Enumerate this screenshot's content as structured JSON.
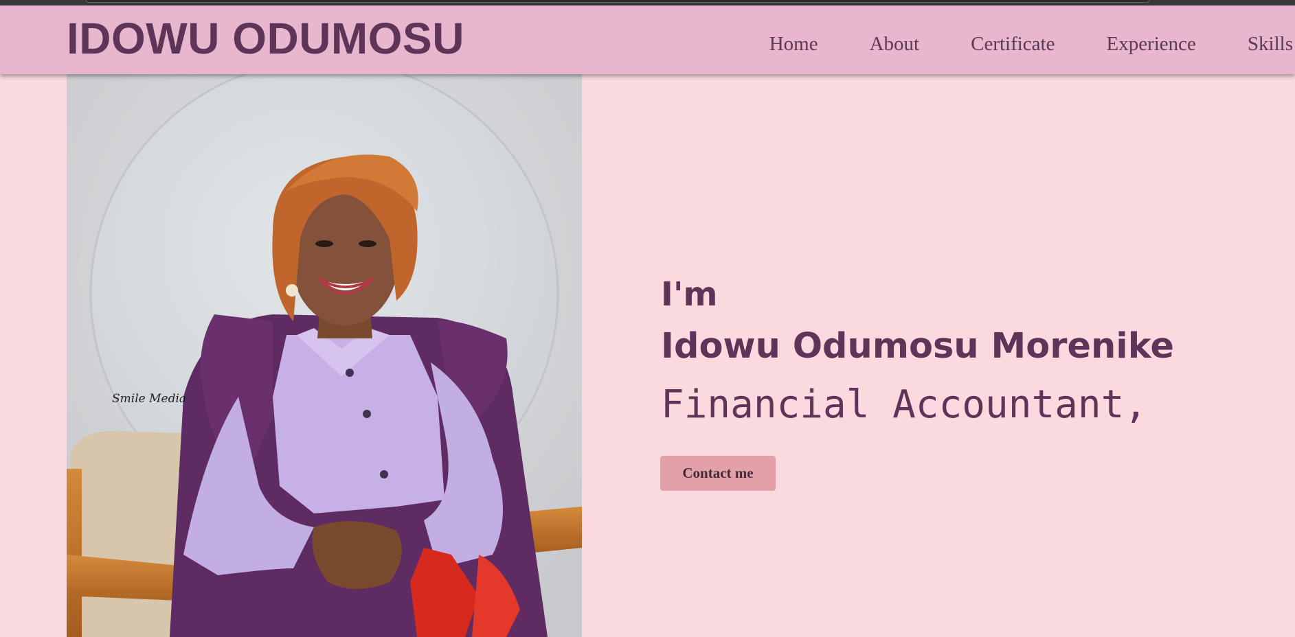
{
  "header": {
    "logo": "IDOWU ODUMOSU",
    "nav": [
      "Home",
      "About",
      "Certificate",
      "Experience",
      "Skills"
    ]
  },
  "hero": {
    "greeting": "I'm",
    "name": "Idowu Odumosu Morenike",
    "role": "Financial Accountant,",
    "contact_button": "Contact me",
    "photo_watermark": "Smile Media"
  },
  "colors": {
    "page_background": "#fadadf",
    "navbar_background": "#e8b7cd",
    "accent_text": "#5e3458",
    "button_background": "#e4a0a8"
  }
}
